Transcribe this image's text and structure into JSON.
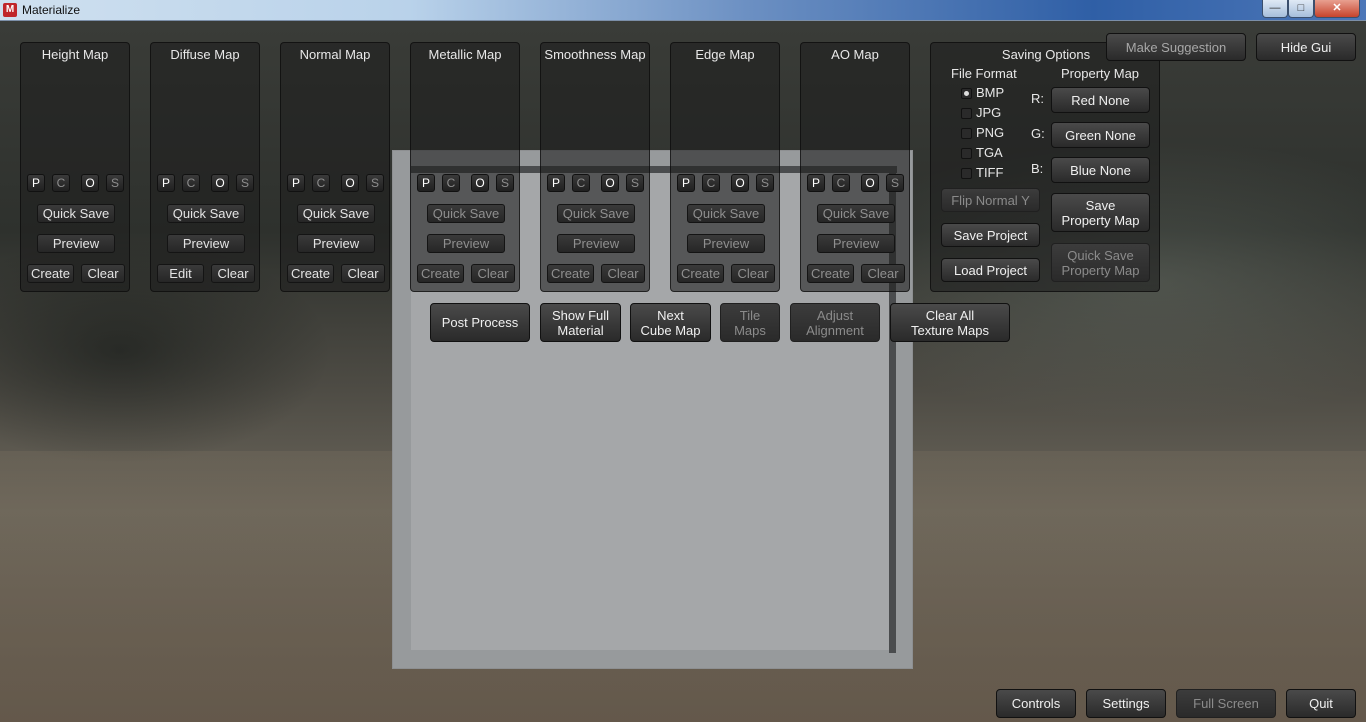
{
  "window": {
    "title": "Materialize",
    "min": "—",
    "max": "□",
    "close": "✕"
  },
  "panels": [
    {
      "title": "Height Map",
      "quick_save": "Quick Save",
      "preview": "Preview",
      "left": "Create",
      "right": "Clear",
      "active": true
    },
    {
      "title": "Diffuse Map",
      "quick_save": "Quick Save",
      "preview": "Preview",
      "left": "Edit",
      "right": "Clear",
      "active": true
    },
    {
      "title": "Normal Map",
      "quick_save": "Quick Save",
      "preview": "Preview",
      "left": "Create",
      "right": "Clear",
      "active": true
    },
    {
      "title": "Metallic Map",
      "quick_save": "Quick Save",
      "preview": "Preview",
      "left": "Create",
      "right": "Clear",
      "active": false
    },
    {
      "title": "Smoothness Map",
      "quick_save": "Quick Save",
      "preview": "Preview",
      "left": "Create",
      "right": "Clear",
      "active": false
    },
    {
      "title": "Edge Map",
      "quick_save": "Quick Save",
      "preview": "Preview",
      "left": "Create",
      "right": "Clear",
      "active": false
    },
    {
      "title": "AO Map",
      "quick_save": "Quick Save",
      "preview": "Preview",
      "left": "Create",
      "right": "Clear",
      "active": false
    }
  ],
  "pcos": {
    "p": "P",
    "c": "C",
    "o": "O",
    "s": "S"
  },
  "actions": {
    "post_process": "Post Process",
    "show_full_material": "Show Full\nMaterial",
    "next_cube_map": "Next\nCube Map",
    "tile_maps": "Tile\nMaps",
    "adjust_alignment": "Adjust\nAlignment",
    "clear_all": "Clear All\nTexture Maps"
  },
  "saving": {
    "title": "Saving Options",
    "file_format_label": "File Format",
    "property_map_label": "Property Map",
    "formats": [
      {
        "label": "BMP",
        "selected": true
      },
      {
        "label": "JPG",
        "selected": false
      },
      {
        "label": "PNG",
        "selected": false
      },
      {
        "label": "TGA",
        "selected": false
      },
      {
        "label": "TIFF",
        "selected": false
      }
    ],
    "channels": [
      {
        "label": "R:",
        "value": "Red None"
      },
      {
        "label": "G:",
        "value": "Green None"
      },
      {
        "label": "B:",
        "value": "Blue None"
      }
    ],
    "flip_normal_y": "Flip Normal Y",
    "save_property_map": "Save\nProperty Map",
    "save_project": "Save Project",
    "load_project": "Load Project",
    "quick_save_property_map": "Quick Save\nProperty Map"
  },
  "top_right": {
    "make_suggestion": "Make Suggestion",
    "hide_gui": "Hide Gui"
  },
  "bottom": {
    "controls": "Controls",
    "settings": "Settings",
    "full_screen": "Full Screen",
    "quit": "Quit"
  }
}
